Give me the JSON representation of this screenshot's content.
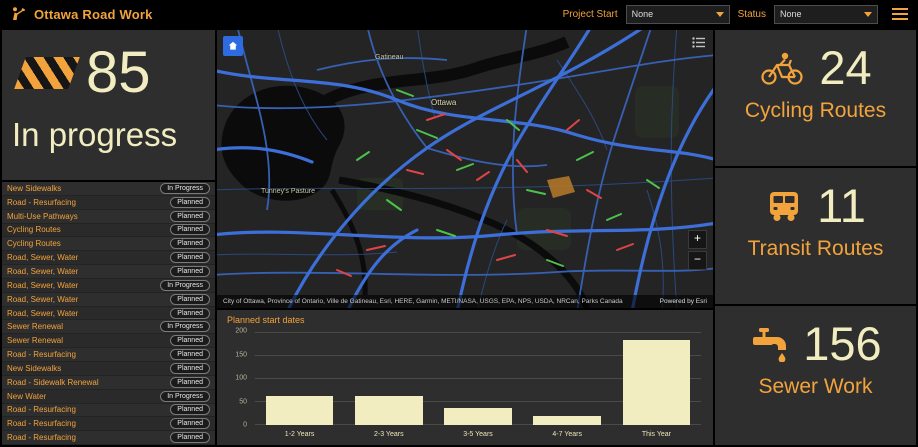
{
  "colors": {
    "accent": "#f2a33c",
    "cream": "#f2edc0",
    "panel": "#2e2e2e",
    "header_bg": "#000000",
    "map_road_blue": "#3d6fd8",
    "map_segment_red": "#e04545",
    "map_segment_green": "#4cc24c"
  },
  "header": {
    "title": "Ottawa Road Work",
    "project_start_label": "Project Start",
    "project_start_value": "None",
    "status_label": "Status",
    "status_value": "None"
  },
  "progress_panel": {
    "value": "85",
    "label": "In progress"
  },
  "project_list": [
    {
      "name": "New Sidewalks",
      "status": "In Progress"
    },
    {
      "name": "Road - Resurfacing",
      "status": "Planned"
    },
    {
      "name": "Multi-Use Pathways",
      "status": "Planned"
    },
    {
      "name": "Cycling Routes",
      "status": "Planned"
    },
    {
      "name": "Cycling Routes",
      "status": "Planned"
    },
    {
      "name": "Road, Sewer, Water",
      "status": "Planned"
    },
    {
      "name": "Road, Sewer, Water",
      "status": "Planned"
    },
    {
      "name": "Road, Sewer, Water",
      "status": "In Progress"
    },
    {
      "name": "Road, Sewer, Water",
      "status": "Planned"
    },
    {
      "name": "Road, Sewer, Water",
      "status": "Planned"
    },
    {
      "name": "Sewer Renewal",
      "status": "In Progress"
    },
    {
      "name": "Sewer Renewal",
      "status": "Planned"
    },
    {
      "name": "Road - Resurfacing",
      "status": "Planned"
    },
    {
      "name": "New Sidewalks",
      "status": "Planned"
    },
    {
      "name": "Road - Sidewalk Renewal",
      "status": "Planned"
    },
    {
      "name": "New Water",
      "status": "In Progress"
    },
    {
      "name": "Road - Resurfacing",
      "status": "Planned"
    },
    {
      "name": "Road - Resurfacing",
      "status": "Planned"
    },
    {
      "name": "Road - Resurfacing",
      "status": "Planned"
    }
  ],
  "map": {
    "labels": {
      "gatineau": "Gatineau",
      "ottawa": "Ottawa",
      "tunneys": "Tunney's Pasture"
    },
    "attribution": "City of Ottawa, Province of Ontario, Ville de Gatineau, Esri, HERE, Garmin, METI/NASA, USGS, EPA, NPS, USDA, NRCan, Parks Canada",
    "powered_by": "Powered by Esri",
    "zoom_in": "+",
    "zoom_out": "−"
  },
  "chart_data": {
    "type": "bar",
    "title": "Planned start dates",
    "categories": [
      "1-2 Years",
      "2-3 Years",
      "3-5 Years",
      "4-7 Years",
      "This Year"
    ],
    "values": [
      62,
      62,
      38,
      20,
      185
    ],
    "xlabel": "",
    "ylabel": "",
    "ylim": [
      0,
      200
    ],
    "yticks": [
      0,
      50,
      100,
      150,
      200
    ],
    "bar_color": "#f2edc0",
    "grid": true,
    "legend": false
  },
  "stats": [
    {
      "icon": "cyclist-icon",
      "value": "24",
      "label": "Cycling Routes"
    },
    {
      "icon": "bus-icon",
      "value": "11",
      "label": "Transit Routes"
    },
    {
      "icon": "faucet-icon",
      "value": "156",
      "label": "Sewer Work"
    }
  ]
}
